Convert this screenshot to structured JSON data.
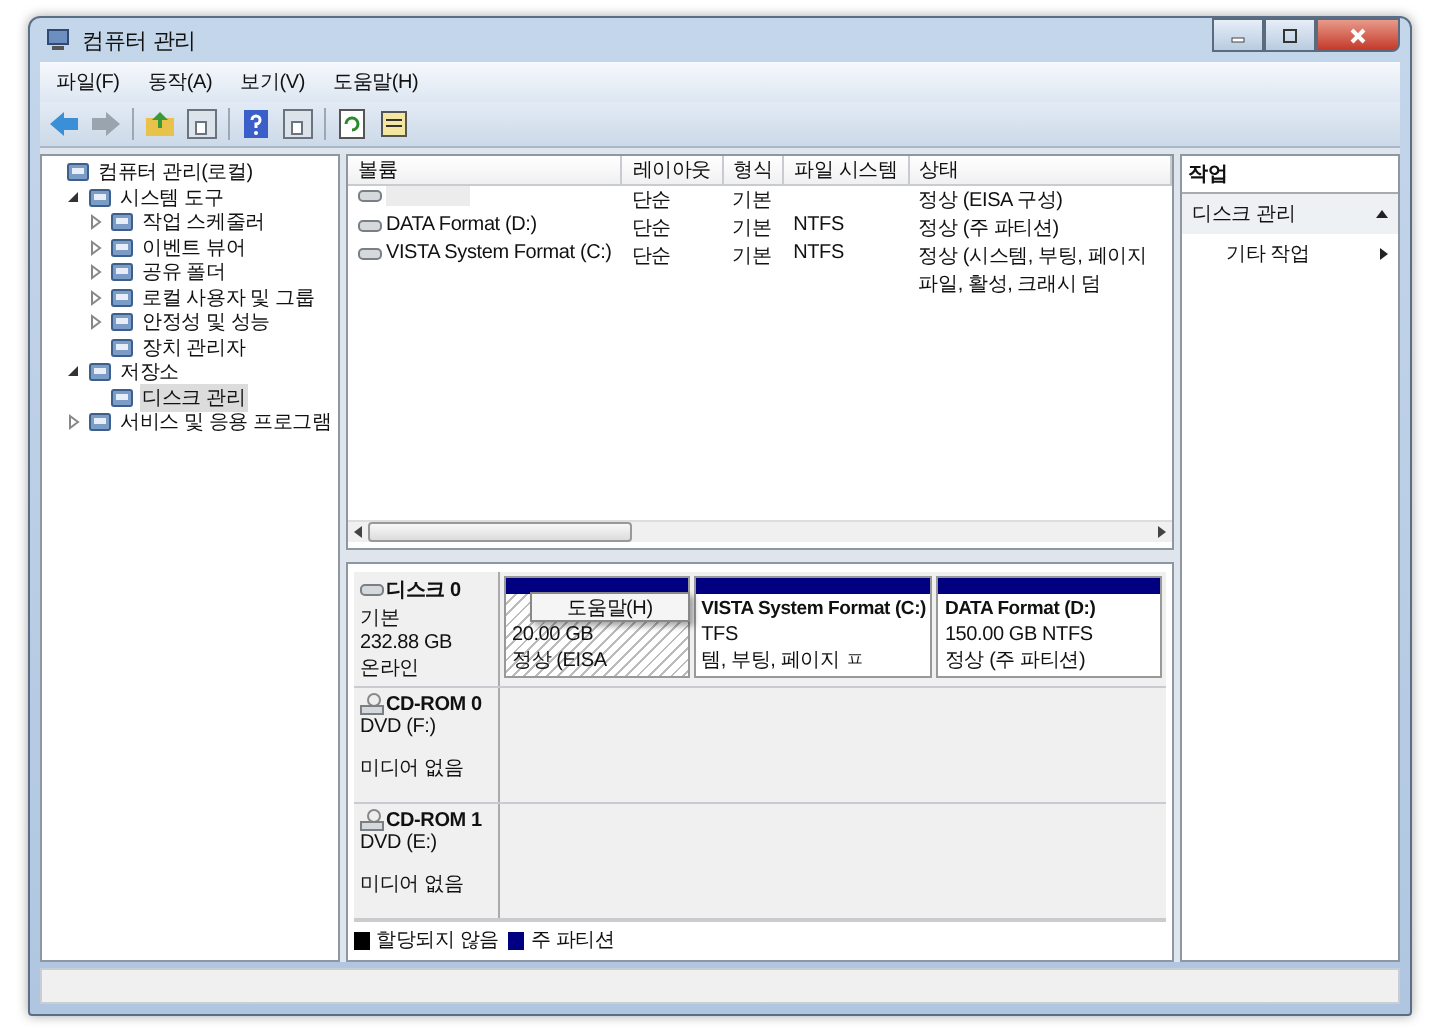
{
  "window": {
    "title": "컴퓨터 관리"
  },
  "menu": [
    "파일(F)",
    "동작(A)",
    "보기(V)",
    "도움말(H)"
  ],
  "tree": [
    {
      "label": "컴퓨터 관리(로컬)",
      "selected": false,
      "children": [
        {
          "label": "시스템 도구",
          "selected": false,
          "expanded": true,
          "children": [
            {
              "label": "작업 스케줄러",
              "selected": false,
              "expanded": false
            },
            {
              "label": "이벤트 뷰어",
              "selected": false,
              "expanded": false
            },
            {
              "label": "공유 폴더",
              "selected": false,
              "expanded": false
            },
            {
              "label": "로컬 사용자 및 그룹",
              "selected": false,
              "expanded": false
            },
            {
              "label": "안정성 및 성능",
              "selected": false,
              "expanded": false
            },
            {
              "label": "장치 관리자",
              "selected": false
            }
          ]
        },
        {
          "label": "저장소",
          "selected": false,
          "expanded": true,
          "children": [
            {
              "label": "디스크 관리",
              "selected": true
            }
          ]
        },
        {
          "label": "서비스 및 응용 프로그램",
          "selected": false,
          "expanded": false
        }
      ]
    }
  ],
  "volume_table": {
    "columns": [
      "볼륨",
      "레이아웃",
      "형식",
      "파일 시스템",
      "상태"
    ],
    "rows": [
      [
        "",
        "단순",
        "기본",
        "",
        "정상 (EISA 구성)"
      ],
      [
        "DATA Format (D:)",
        "단순",
        "기본",
        "NTFS",
        "정상 (주 파티션)"
      ],
      [
        "VISTA System Format (C:)",
        "단순",
        "기본",
        "NTFS",
        "정상 (시스템, 부팅, 페이지 파일, 활성, 크래시 덤"
      ]
    ]
  },
  "disks": [
    {
      "kind": "disk",
      "name": "디스크 0",
      "lines": [
        "기본",
        "232.88 GB",
        "온라인"
      ],
      "partitions": [
        {
          "lines": [
            "20.00 GB",
            "정상 (EISA"
          ],
          "selected": true
        },
        {
          "title": "VISTA System Format  (C:)",
          "lines": [
            "TFS",
            "템, 부팅, 페이지 ㅍ"
          ],
          "selected": false
        },
        {
          "title": "DATA Format  (D:)",
          "lines": [
            "150.00 GB NTFS",
            "정상 (주 파티션)"
          ],
          "selected": false
        }
      ]
    },
    {
      "kind": "cdrom",
      "name": "CD-ROM 0",
      "lines": [
        "DVD (F:)",
        "미디어 없음"
      ]
    },
    {
      "kind": "cdrom",
      "name": "CD-ROM 1",
      "lines": [
        "DVD (E:)",
        "미디어 없음"
      ]
    }
  ],
  "legend": [
    {
      "label": "할당되지 않음",
      "color": "#000000"
    },
    {
      "label": "주 파티션",
      "color": "#000080"
    }
  ],
  "context_menu": [
    "도움말(H)"
  ],
  "actions": {
    "title": "작업",
    "sections": [
      {
        "label": "디스크 관리",
        "expanded": true,
        "items": [
          "기타 작업"
        ]
      }
    ]
  }
}
